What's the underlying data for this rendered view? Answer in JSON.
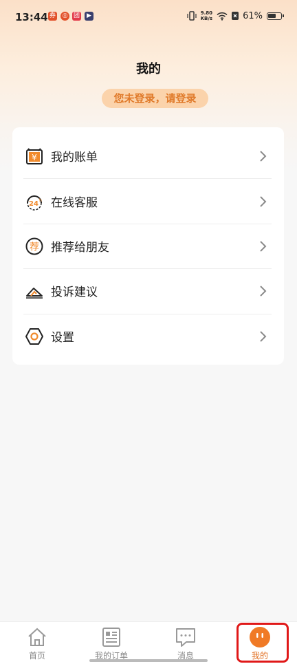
{
  "status_bar": {
    "time": "13:44",
    "net_speed_value": "9.80",
    "net_speed_unit": "KB/s",
    "battery": "61%"
  },
  "header": {
    "title": "我的",
    "login_prompt": "您未登录，请登录"
  },
  "menu": {
    "items": [
      {
        "label": "我的账单",
        "icon": "bill-icon"
      },
      {
        "label": "在线客服",
        "icon": "customer-service-24h-icon"
      },
      {
        "label": "推荐给朋友",
        "icon": "recommend-icon"
      },
      {
        "label": "投诉建议",
        "icon": "feedback-icon"
      },
      {
        "label": "设置",
        "icon": "settings-icon"
      }
    ]
  },
  "tabbar": {
    "tabs": [
      {
        "label": "首页",
        "icon": "home-icon"
      },
      {
        "label": "我的订单",
        "icon": "orders-icon"
      },
      {
        "label": "消息",
        "icon": "message-icon"
      },
      {
        "label": "我的",
        "icon": "profile-icon",
        "active": true
      }
    ]
  },
  "colors": {
    "accent": "#e06a1a",
    "highlight": "#e01818"
  }
}
